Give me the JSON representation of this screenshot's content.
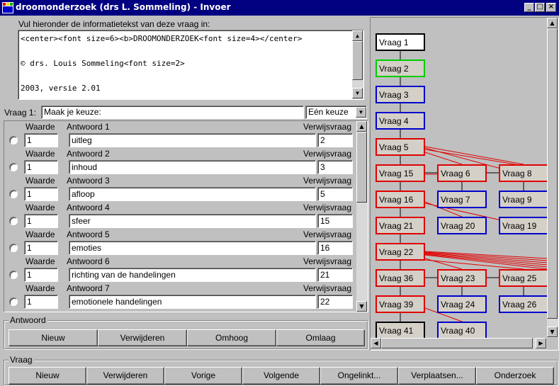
{
  "window": {
    "title": "droomonderzoek (drs L. Sommeling) - Invoer"
  },
  "info": {
    "label": "Vul hieronder de informatietekst van deze vraag in:",
    "lines": [
      "<center><font size=6><b>DROOMONDERZOEK<font size=4></center>",
      "",
      "© drs. Louis Sommeling<font size=2>",
      "",
      "2003, versie 2.01"
    ]
  },
  "question": {
    "label": "Vraag 1:",
    "value": "Maak  je keuze:",
    "type_value": "Eén keuze"
  },
  "answers": [
    {
      "waarde_label": "Waarde",
      "antwoord_label": "Antwoord 1",
      "verwijs_label": "Verwijsvraag",
      "waarde": "1",
      "text": "uitleg",
      "verwijs": "2"
    },
    {
      "waarde_label": "Waarde",
      "antwoord_label": "Antwoord 2",
      "verwijs_label": "Verwijsvraag",
      "waarde": "1",
      "text": "inhoud",
      "verwijs": "3"
    },
    {
      "waarde_label": "Waarde",
      "antwoord_label": "Antwoord 3",
      "verwijs_label": "Verwijsvraag",
      "waarde": "1",
      "text": "afloop",
      "verwijs": "5"
    },
    {
      "waarde_label": "Waarde",
      "antwoord_label": "Antwoord 4",
      "verwijs_label": "Verwijsvraag",
      "waarde": "1",
      "text": "sfeer",
      "verwijs": "15"
    },
    {
      "waarde_label": "Waarde",
      "antwoord_label": "Antwoord 5",
      "verwijs_label": "Verwijsvraag",
      "waarde": "1",
      "text": "emoties",
      "verwijs": "16"
    },
    {
      "waarde_label": "Waarde",
      "antwoord_label": "Antwoord 6",
      "verwijs_label": "Verwijsvraag",
      "waarde": "1",
      "text": "richting van de handelingen",
      "verwijs": "21"
    },
    {
      "waarde_label": "Waarde",
      "antwoord_label": "Antwoord 7",
      "verwijs_label": "Verwijsvraag",
      "waarde": "1",
      "text": "emotionele handelingen",
      "verwijs": "22"
    }
  ],
  "antwoord_group": {
    "label": "Antwoord",
    "buttons": [
      "Nieuw",
      "Verwijderen",
      "Omhoog",
      "Omlaag"
    ]
  },
  "vraag_group": {
    "label": "Vraag",
    "buttons": [
      "Nieuw",
      "Verwijderen",
      "Vorige",
      "Volgende",
      "Ongelinkt...",
      "Verplaatsen...",
      "Onderzoek"
    ]
  },
  "tree": {
    "colors": {
      "selected": "#000000",
      "visited": "#00cc00",
      "leaf": "#0000cc",
      "branch": "#e00000"
    },
    "nodes": [
      {
        "id": "n1",
        "label": "Vraag 1",
        "state": "selected"
      },
      {
        "id": "n2",
        "label": "Vraag 2",
        "state": "visited"
      },
      {
        "id": "n3",
        "label": "Vraag 3",
        "state": "leaf"
      },
      {
        "id": "n4",
        "label": "Vraag 4",
        "state": "leaf"
      },
      {
        "id": "n5",
        "label": "Vraag 5",
        "state": "branch"
      },
      {
        "id": "n15",
        "label": "Vraag 15",
        "state": "branch"
      },
      {
        "id": "n6",
        "label": "Vraag 6",
        "state": "branch"
      },
      {
        "id": "n8",
        "label": "Vraag 8",
        "state": "branch"
      },
      {
        "id": "n16",
        "label": "Vraag 16",
        "state": "branch"
      },
      {
        "id": "n7",
        "label": "Vraag 7",
        "state": "leaf"
      },
      {
        "id": "n9",
        "label": "Vraag 9",
        "state": "leaf"
      },
      {
        "id": "n21",
        "label": "Vraag 21",
        "state": "branch"
      },
      {
        "id": "n20",
        "label": "Vraag 20",
        "state": "leaf"
      },
      {
        "id": "n19",
        "label": "Vraag 19",
        "state": "leaf"
      },
      {
        "id": "n22",
        "label": "Vraag 22",
        "state": "branch"
      },
      {
        "id": "n36",
        "label": "Vraag 36",
        "state": "branch"
      },
      {
        "id": "n23",
        "label": "Vraag 23",
        "state": "branch"
      },
      {
        "id": "n25",
        "label": "Vraag 25",
        "state": "branch"
      },
      {
        "id": "n39",
        "label": "Vraag 39",
        "state": "branch"
      },
      {
        "id": "n24",
        "label": "Vraag 24",
        "state": "leaf"
      },
      {
        "id": "n26",
        "label": "Vraag 26",
        "state": "leaf"
      },
      {
        "id": "n41",
        "label": "Vraag 41",
        "state": "selected"
      },
      {
        "id": "n40",
        "label": "Vraag 40",
        "state": "leaf"
      }
    ]
  }
}
